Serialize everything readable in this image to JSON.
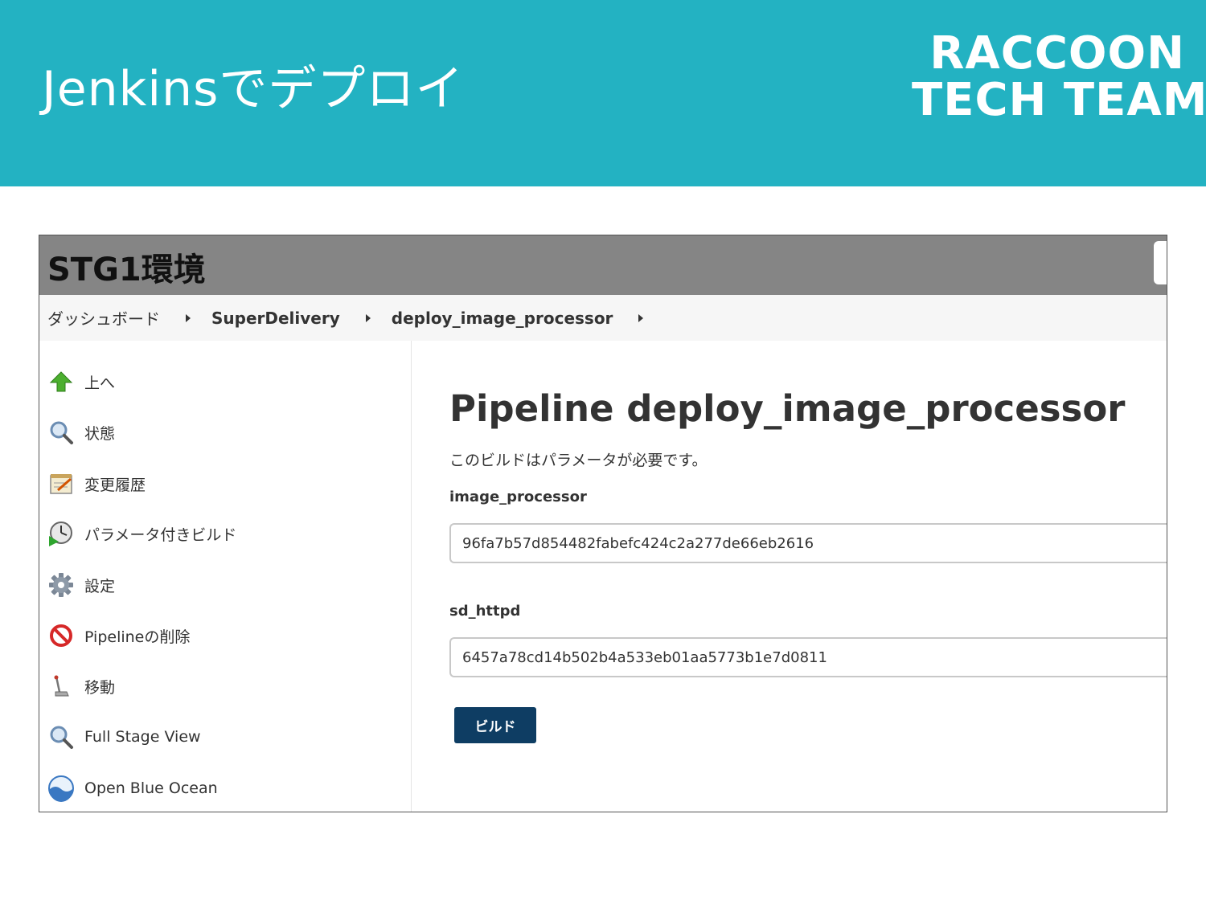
{
  "slide": {
    "title": "Jenkinsでデプロイ",
    "brand_line1": "RACCOON",
    "brand_line2": "TECH TEAM",
    "accent_color": "#23b2c2"
  },
  "jenkins": {
    "environment_title": "STG1環境",
    "breadcrumb": [
      "ダッシュボード",
      "SuperDelivery",
      "deploy_image_processor"
    ],
    "side_tasks": [
      {
        "label": "上へ",
        "icon": "up-arrow-icon"
      },
      {
        "label": "状態",
        "icon": "magnifier-icon"
      },
      {
        "label": "変更履歴",
        "icon": "notepad-icon"
      },
      {
        "label": "パラメータ付きビルド",
        "icon": "clock-play-icon"
      },
      {
        "label": "設定",
        "icon": "gear-icon"
      },
      {
        "label": "Pipelineの削除",
        "icon": "no-entry-icon"
      },
      {
        "label": "移動",
        "icon": "move-icon"
      },
      {
        "label": "Full Stage View",
        "icon": "magnifier-icon"
      },
      {
        "label": "Open Blue Ocean",
        "icon": "blue-ocean-icon"
      }
    ],
    "main": {
      "title": "Pipeline deploy_image_processor",
      "note": "このビルドはパラメータが必要です。",
      "params": [
        {
          "name": "image_processor",
          "value": "96fa7b57d854482fabefc424c2a277de66eb2616"
        },
        {
          "name": "sd_httpd",
          "value": "6457a78cd14b502b4a533eb01aa5773b1e7d0811"
        }
      ],
      "build_label": "ビルド",
      "build_button_color": "#0e3d63"
    }
  }
}
